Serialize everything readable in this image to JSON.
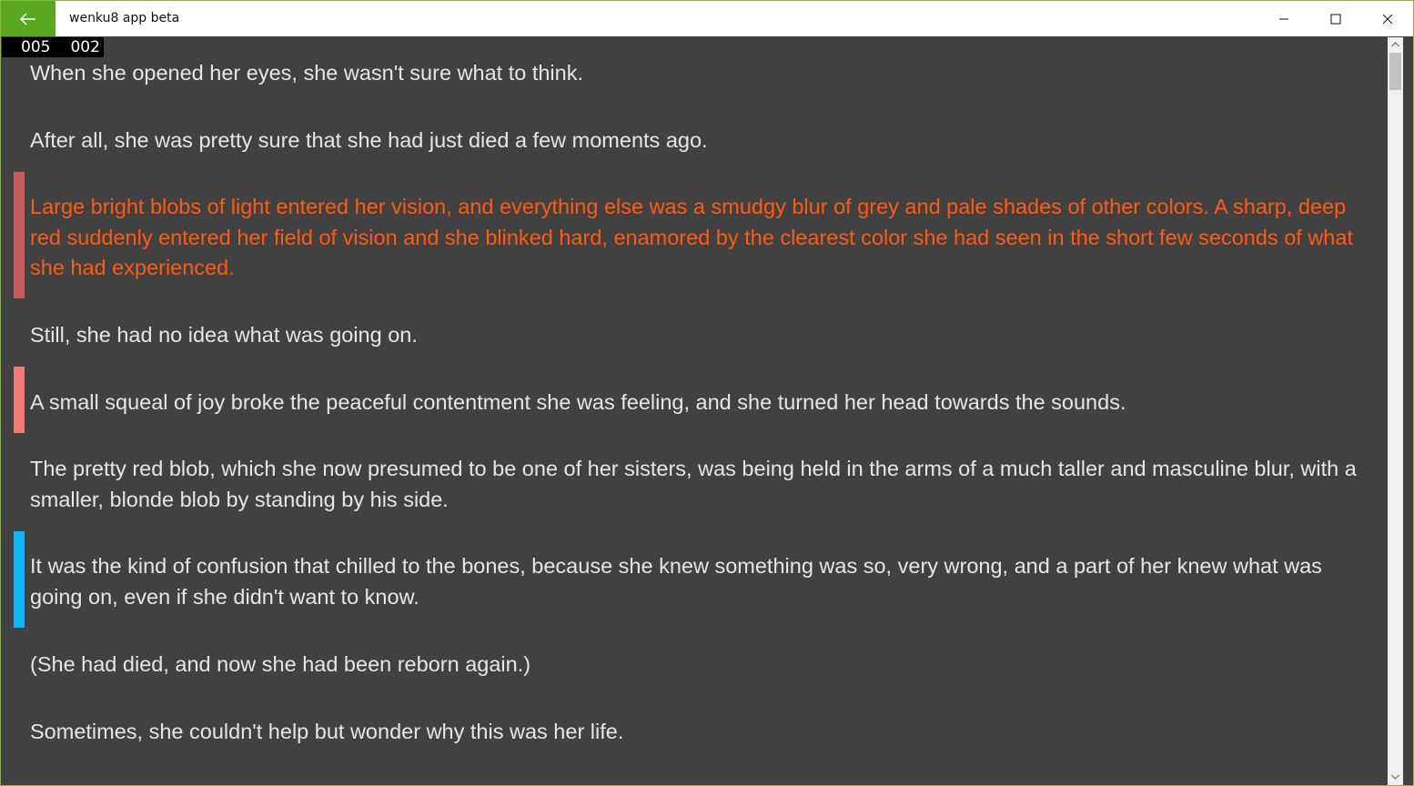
{
  "window": {
    "title": "wenku8 app beta",
    "accent_color": "#5aa822",
    "back_icon": "arrow-left-icon",
    "minimize_icon": "minimize-icon",
    "maximize_icon": "maximize-icon",
    "close_icon": "close-icon"
  },
  "counter": {
    "chapter": "005",
    "page": "002"
  },
  "reader": {
    "text_color": "#e6e6e6",
    "highlight_text_color": "#ff5a14",
    "paragraphs": [
      {
        "text": "When she opened her eyes, she wasn't sure what to think."
      },
      {
        "text": "After all, she was pretty sure that she had just died a few moments ago."
      },
      {
        "text": "Large bright blobs of light entered her vision, and everything else was a smudgy blur of grey and pale shades of other colors. A sharp, deep red suddenly entered her field of vision and she blinked hard, enamored by the clearest color she had seen in the short few seconds of what she had experienced.",
        "mark_color": "#c75a5a",
        "highlight": true
      },
      {
        "text": "Still, she had no idea what was going on."
      },
      {
        "text": "A small squeal of joy broke the peaceful contentment she was feeling, and she turned her head towards the sounds.",
        "mark_color": "#f07a7a"
      },
      {
        "text": "The pretty red blob, which she now presumed to be one of her sisters, was being held in the arms of a much taller and masculine blur, with a smaller, blonde blob by standing by his side."
      },
      {
        "text": "It was the kind of confusion that chilled to the bones, because she knew something was so, very wrong, and a part of her knew what was going on, even if she didn't want to know.",
        "mark_color": "#10b4f0"
      },
      {
        "text": "(She had died, and now she had been reborn again.)"
      },
      {
        "text": "Sometimes, she couldn't help but wonder why this was her life."
      }
    ]
  },
  "scrollbar": {
    "up_icon": "scroll-up-arrow-icon",
    "down_icon": "scroll-down-arrow-icon"
  }
}
